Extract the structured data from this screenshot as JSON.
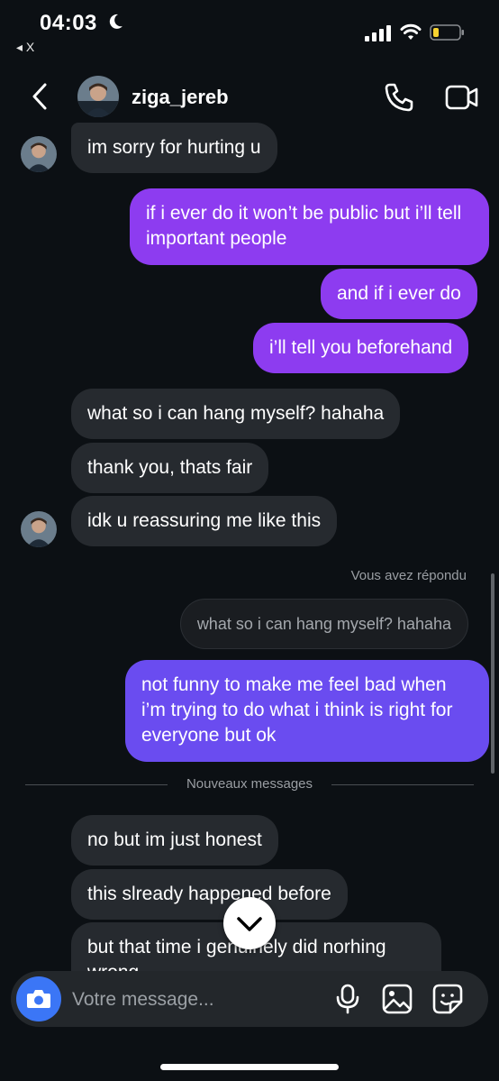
{
  "status_bar": {
    "time": "04:03",
    "back_label": "◂ X"
  },
  "header": {
    "username": "ziga_jereb"
  },
  "messages": {
    "m1": "im sorry for hurting u",
    "m2": "if i ever do it won’t be public but i’ll tell important people",
    "m3": "and if i ever do",
    "m4": "i’ll tell you beforehand",
    "m5": "what so i can hang myself? hahaha",
    "m6": "thank you, thats fair",
    "m7": "idk u reassuring me like this",
    "replied_label": "Vous avez répondu",
    "quoted": "what so i can hang myself? hahaha",
    "m8": "not funny to make me feel bad when i’m trying to do what i think is right for everyone but ok",
    "new_messages_divider": "Nouveaux messages",
    "m9": "no but im just honest",
    "m10": "this slready happened before",
    "m11": "but that time i genuinely did norhing wrong"
  },
  "composer": {
    "placeholder": "Votre message..."
  },
  "colors": {
    "sent_purple": "#8d3cf0",
    "sent_indigo": "#6a4cf0",
    "camera_blue": "#3b76f6",
    "received": "#262a2f"
  },
  "icons": [
    "moon-icon",
    "signal-icon",
    "wifi-icon",
    "battery-icon",
    "back-chevron-icon",
    "phone-icon",
    "video-camera-icon",
    "chevron-down-icon",
    "camera-icon",
    "microphone-icon",
    "gallery-icon",
    "sticker-icon"
  ]
}
